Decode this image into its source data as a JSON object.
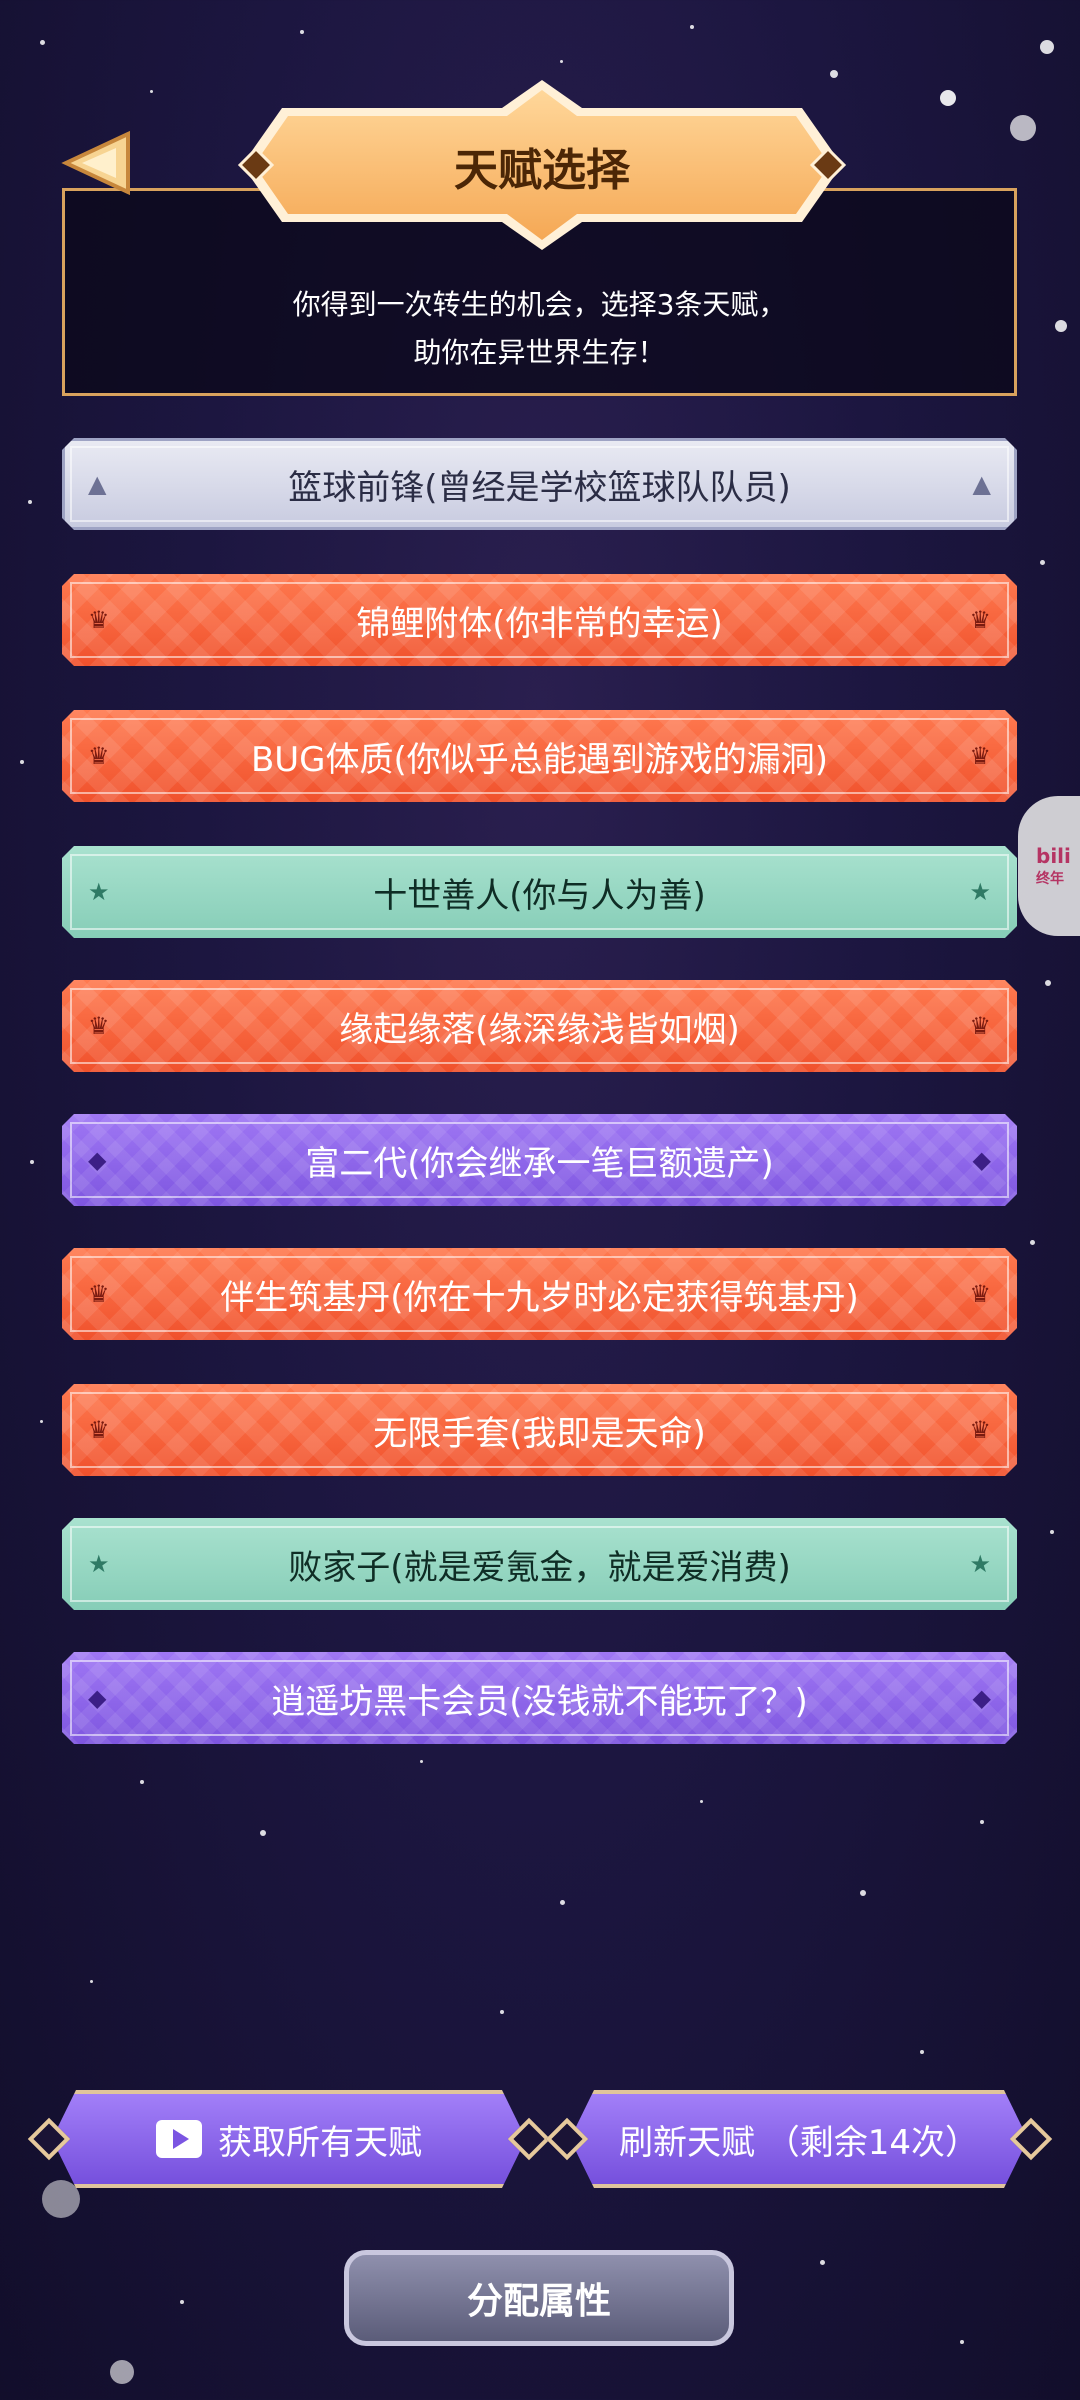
{
  "header": {
    "title": "天赋选择",
    "description_line1": "你得到一次转生的机会，选择3条天赋，",
    "description_line2": "助你在异世界生存！"
  },
  "talents": [
    {
      "label": "篮球前锋(曾经是学校篮球队队员)",
      "rarity": "gray",
      "icon": "triangle-icon"
    },
    {
      "label": "锦鲤附体(你非常的幸运)",
      "rarity": "orange",
      "icon": "crown-icon"
    },
    {
      "label": "BUG体质(你似乎总能遇到游戏的漏洞)",
      "rarity": "orange",
      "icon": "crown-icon"
    },
    {
      "label": "十世善人(你与人为善)",
      "rarity": "green",
      "icon": "star-icon"
    },
    {
      "label": "缘起缘落(缘深缘浅皆如烟)",
      "rarity": "orange",
      "icon": "crown-icon"
    },
    {
      "label": "富二代(你会继承一笔巨额遗产)",
      "rarity": "purple",
      "icon": "diamond-icon"
    },
    {
      "label": "伴生筑基丹(你在十九岁时必定获得筑基丹)",
      "rarity": "orange",
      "icon": "crown-icon"
    },
    {
      "label": "无限手套(我即是天命)",
      "rarity": "orange",
      "icon": "crown-icon"
    },
    {
      "label": "败家子(就是爱氪金，就是爱消费)",
      "rarity": "green",
      "icon": "star-icon"
    },
    {
      "label": "逍遥坊黑卡会员(没钱就不能玩了？)",
      "rarity": "purple",
      "icon": "diamond-icon"
    }
  ],
  "actions": {
    "get_all_label": "获取所有天赋",
    "refresh_label": "刷新天赋 （剩余14次）",
    "allocate_label": "分配属性"
  },
  "watermark": {
    "text": "bili",
    "subtext": "终年"
  },
  "colors": {
    "gold": "#d8a25d",
    "orange": "#f0512c",
    "purple": "#7e56e0",
    "green": "#86cdb7",
    "gray": "#c8cbe0"
  }
}
